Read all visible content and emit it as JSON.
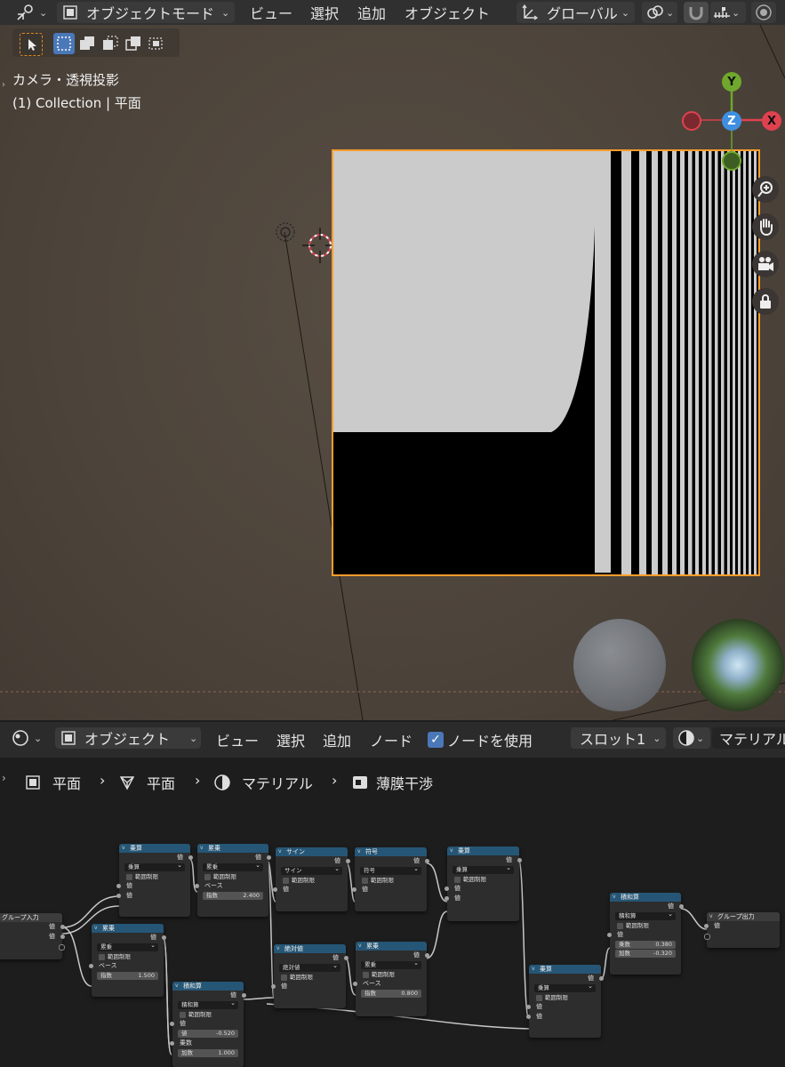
{
  "viewport_header": {
    "mode_label": "オブジェクトモード",
    "menus": [
      "ビュー",
      "選択",
      "追加",
      "オブジェクト"
    ],
    "transform_orientation": "グローバル"
  },
  "viewport": {
    "camera_label": "カメラ・透視投影",
    "collection_label": "(1) Collection | 平面",
    "gizmo_axes": {
      "y": "Y",
      "z": "Z",
      "x": "X"
    },
    "colors": {
      "x_axis": "#e0414f",
      "y_axis": "#6fa82c",
      "z_axis": "#3f8fe0",
      "selection_outline": "#ff9d2c"
    }
  },
  "node_header": {
    "mode_label": "オブジェクト",
    "menus": [
      "ビュー",
      "選択",
      "追加",
      "ノード"
    ],
    "use_nodes_label": "ノードを使用",
    "slot_label": "スロット1",
    "material_label": "マテリアル"
  },
  "breadcrumb": [
    "平面",
    "平面",
    "マテリアル",
    "薄膜干渉"
  ],
  "nodes": {
    "group_input": {
      "title": "グループ入力",
      "out1": "値",
      "out2": "値"
    },
    "power_top": {
      "title": "乗算",
      "op": "乗算",
      "clamp": "範囲制限",
      "in1": "値",
      "in2": "値",
      "out": "値"
    },
    "power2": {
      "title": "累乗",
      "op": "累乗",
      "clamp": "範囲制限",
      "base": "ベース",
      "exp_label": "指数",
      "exp_value": "2.400",
      "out": "値"
    },
    "sine": {
      "title": "サイン",
      "op": "サイン",
      "clamp": "範囲制限",
      "in1": "値",
      "out": "値"
    },
    "sign": {
      "title": "符号",
      "op": "符号",
      "clamp": "範囲制限",
      "in1": "値",
      "out": "値"
    },
    "multiply_right": {
      "title": "乗算",
      "op": "乗算",
      "clamp": "範囲制限",
      "in1": "値",
      "in2": "値",
      "out": "値"
    },
    "power1": {
      "title": "累乗",
      "op": "累乗",
      "clamp": "範囲制限",
      "base": "ベース",
      "exp_label": "指数",
      "exp_value": "1.500",
      "out": "値"
    },
    "abs": {
      "title": "絶対値",
      "op": "絶対値",
      "clamp": "範囲制限",
      "in1": "値",
      "out": "値"
    },
    "power3": {
      "title": "累乗",
      "op": "累乗",
      "clamp": "範囲制限",
      "base": "ベース",
      "exp_label": "指数",
      "exp_value": "0.800",
      "out": "値"
    },
    "multiply_add1": {
      "title": "積和算",
      "op": "積和算",
      "clamp": "範囲制限",
      "in1": "値",
      "v_label": "値",
      "v_value": "-0.520",
      "mul_label": "乗数",
      "add_label": "加数",
      "add_value": "1.000",
      "out": "値"
    },
    "multiply_bottom": {
      "title": "乗算",
      "op": "乗算",
      "clamp": "範囲制限",
      "in1": "値",
      "in2": "値",
      "out": "値"
    },
    "multiply_add2": {
      "title": "積和算",
      "op": "積和算",
      "clamp": "範囲制限",
      "in1": "値",
      "mul_label": "乗数",
      "mul_value": "0.380",
      "add_label": "加数",
      "add_value": "-0.320",
      "out": "値"
    },
    "group_output": {
      "title": "グループ出力",
      "in1": "値"
    }
  }
}
